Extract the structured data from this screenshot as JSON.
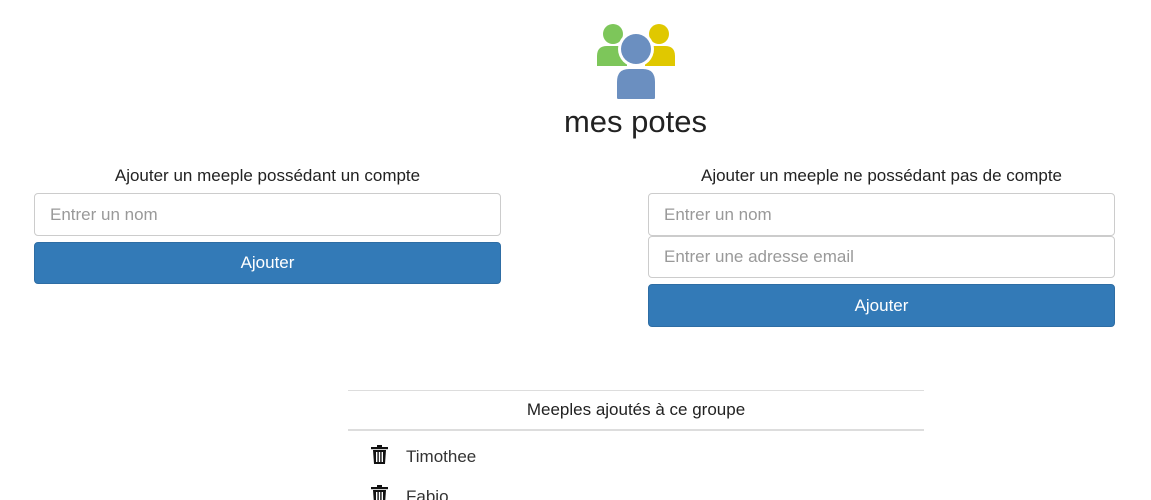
{
  "app": {
    "logo_icon": "group-people-icon",
    "title": "mes potes"
  },
  "add_account_meeple": {
    "heading": "Ajouter un meeple possédant un compte",
    "name_placeholder": "Entrer un nom",
    "name_value": "",
    "button_label": "Ajouter"
  },
  "add_guest_meeple": {
    "heading": "Ajouter un meeple ne possédant pas de compte",
    "name_placeholder": "Entrer un nom",
    "name_value": "",
    "email_placeholder": "Entrer une adresse email",
    "email_value": "",
    "button_label": "Ajouter"
  },
  "members": {
    "header": "Meeples ajoutés à ce groupe",
    "delete_icon": "trash-icon",
    "items": [
      {
        "name": "Timothee"
      },
      {
        "name": "Fabio"
      }
    ]
  },
  "colors": {
    "primary_button": "#337ab7",
    "logo_green": "#7dc65a",
    "logo_yellow": "#e0c800",
    "logo_blue": "#6b8fc0"
  }
}
